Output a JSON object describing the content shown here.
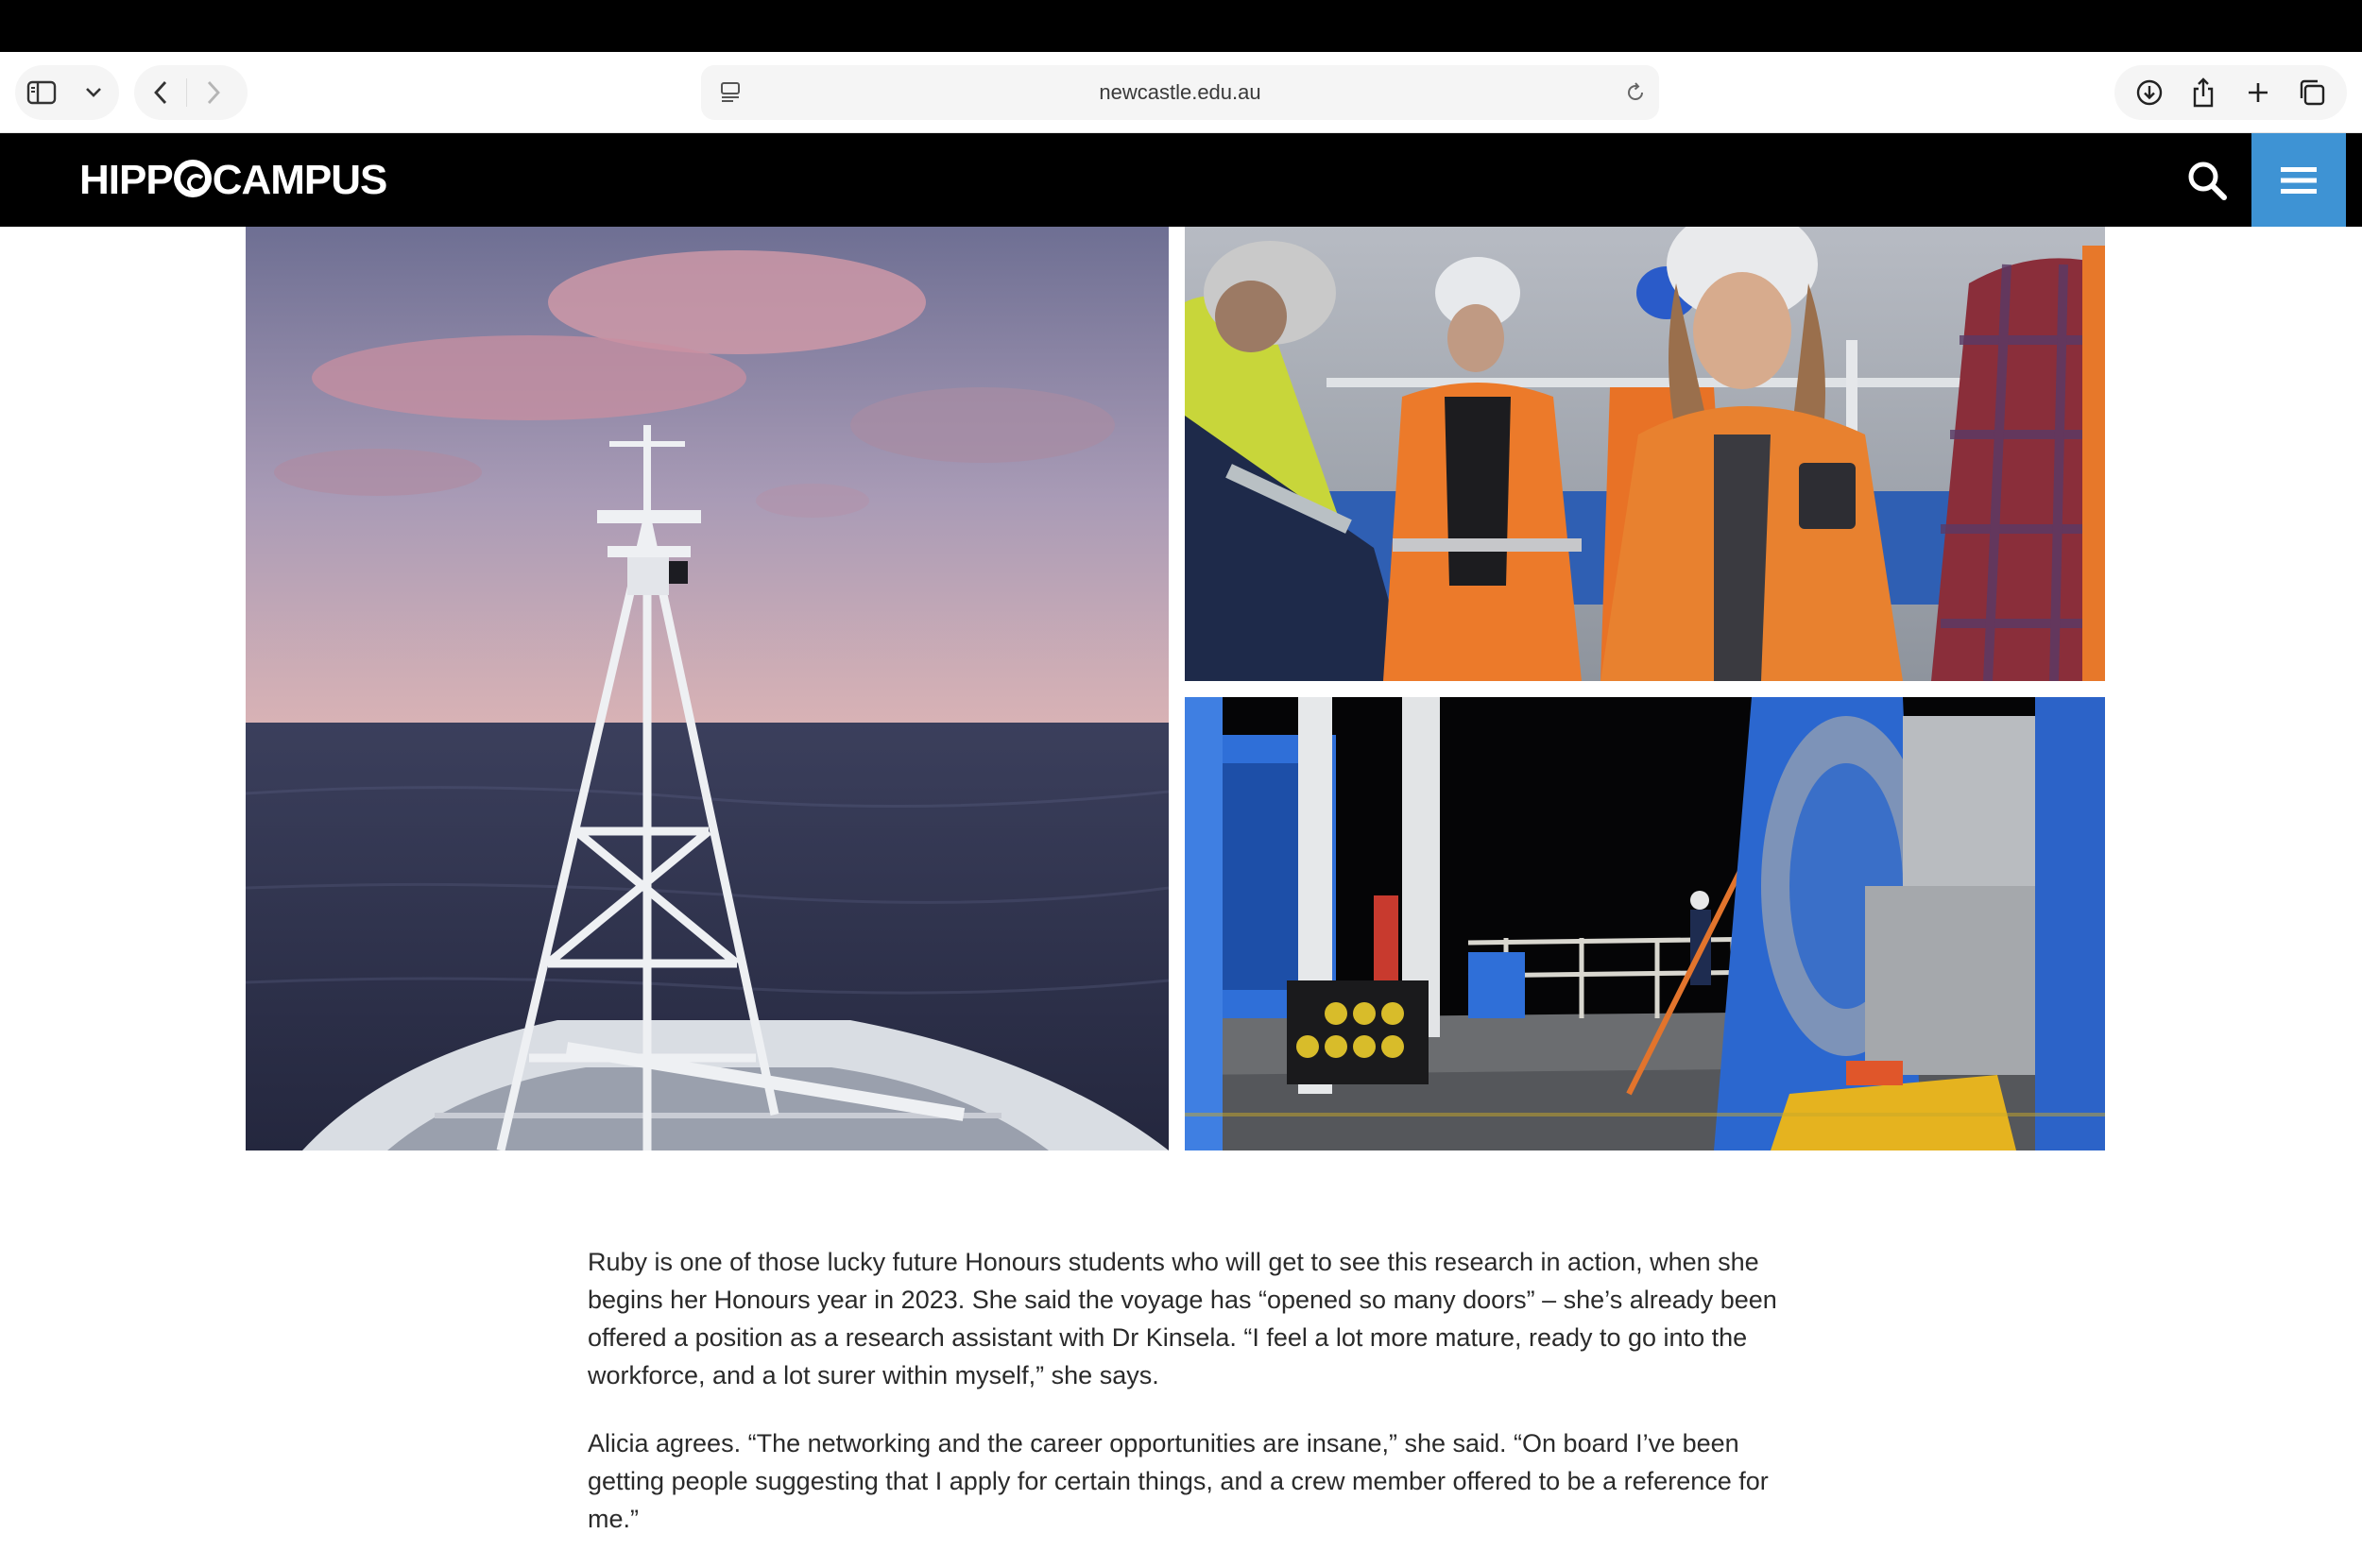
{
  "browser": {
    "url": "newcastle.edu.au"
  },
  "site": {
    "logo_left": "HIPP",
    "logo_right": "CAMPUS"
  },
  "photos": [
    "ship-mast-at-sea",
    "crew-on-deck",
    "deck-at-night"
  ],
  "article": {
    "paragraphs": [
      "Ruby is one of those lucky future Honours students who will get to see this research in action, when she begins her Honours year in 2023. She said the voyage has “opened so many doors” – she’s already been offered a position as a research assistant with Dr Kinsela. “I feel a lot more mature, ready to go into the workforce, and a lot surer within myself,” she says.",
      "Alicia agrees. “The networking and the career opportunities are insane,” she said. “On board I’ve been getting people suggesting that I apply for certain things, and a crew member offered to be a reference for me.”"
    ]
  },
  "colors": {
    "menu_button": "#3e93d4",
    "site_bar": "#000000"
  }
}
